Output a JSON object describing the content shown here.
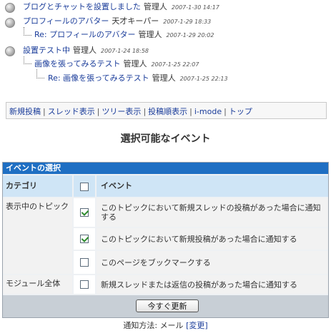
{
  "threads": [
    {
      "title": "ブログとチャットを設置しました",
      "author": "管理人",
      "date": "2007-1-30 14:17"
    },
    {
      "title": "プロフィールのアバター",
      "author": "天才キーパー",
      "date": "2007-1-29 18:33"
    },
    {
      "title": "Re: プロフィールのアバター",
      "author": "管理人",
      "date": "2007-1-29 20:02"
    },
    {
      "title": "設置テスト中",
      "author": "管理人",
      "date": "2007-1-24 18:58"
    },
    {
      "title": "画像を張ってみるテスト",
      "author": "管理人",
      "date": "2007-1-25 22:07"
    },
    {
      "title": "Re: 画像を張ってみるテスト",
      "author": "管理人",
      "date": "2007-1-25 22:13"
    }
  ],
  "nav": [
    "新規投稿",
    "スレッド表示",
    "ツリー表示",
    "投稿順表示",
    "i-mode",
    "トップ"
  ],
  "nav_sep": "|",
  "page_title": "選択可能なイベント",
  "panel": {
    "heading": "イベントの選択",
    "col_category": "カテゴリ",
    "col_event": "イベント",
    "categories": [
      "表示中のトピック",
      "モジュール全体"
    ],
    "events": [
      {
        "text": "このトピックにおいて新規スレッドの投稿があった場合に通知する",
        "checked": true
      },
      {
        "text": "このトピックにおいて新規投稿があった場合に通知する",
        "checked": true
      },
      {
        "text": "このページをブックマークする",
        "checked": false
      },
      {
        "text": "新規スレッドまたは返信の投稿があった場合に通知する",
        "checked": false
      }
    ],
    "submit_label": "今すぐ更新"
  },
  "notify": {
    "prefix": "通知方法:",
    "method": "メール",
    "change_label": "[変更]"
  },
  "colors": {
    "panel_header": "#1f6fc3",
    "column_header": "#cfe5f6",
    "link": "#1a3c9a",
    "check": "#2c8a2c"
  }
}
